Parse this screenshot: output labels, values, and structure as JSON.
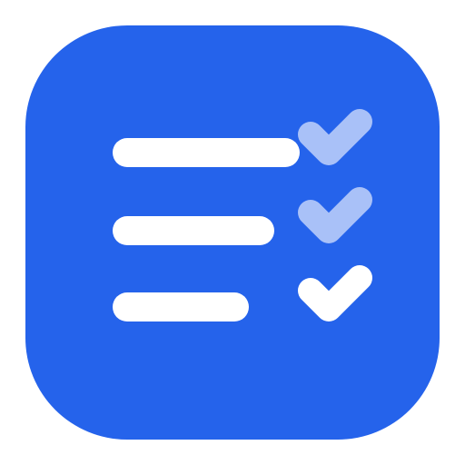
{
  "icon": {
    "name": "checklist-app-icon",
    "background_color": "#2563EB",
    "line_color": "#FFFFFF",
    "check_colors": {
      "faded": "#A9C1F8",
      "active": "#FFFFFF"
    },
    "rows": [
      {
        "name": "checklist-row-1",
        "checked": true,
        "emphasis": "faded"
      },
      {
        "name": "checklist-row-2",
        "checked": true,
        "emphasis": "faded"
      },
      {
        "name": "checklist-row-3",
        "checked": true,
        "emphasis": "active"
      }
    ]
  }
}
